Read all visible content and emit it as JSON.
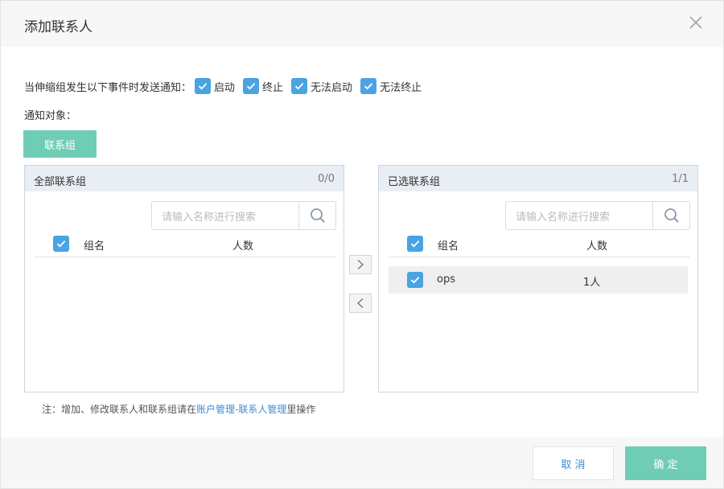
{
  "dialog": {
    "title": "添加联系人",
    "close_icon": "close-icon"
  },
  "notify": {
    "label": "当伸缩组发生以下事件时发送通知：",
    "options": [
      {
        "label": "启动",
        "checked": true
      },
      {
        "label": "终止",
        "checked": true
      },
      {
        "label": "无法启动",
        "checked": true
      },
      {
        "label": "无法终止",
        "checked": true
      }
    ]
  },
  "target": {
    "label": "通知对象：",
    "group_button": "联系组"
  },
  "left_panel": {
    "title": "全部联系组",
    "count": "0/0",
    "search_placeholder": "请输入名称进行搜索",
    "columns": [
      "组名",
      "人数"
    ],
    "rows": []
  },
  "right_panel": {
    "title": "已选联系组",
    "count": "1/1",
    "search_placeholder": "请输入名称进行搜索",
    "columns": [
      "组名",
      "人数"
    ],
    "rows": [
      {
        "name": "ops",
        "count": "1人",
        "checked": true
      }
    ]
  },
  "transfer": {
    "right_icon": "chevron-right-icon",
    "left_icon": "chevron-left-icon"
  },
  "note": {
    "prefix": "注：增加、修改联系人和联系组请在",
    "link": "账户管理-联系人管理",
    "suffix": "里操作"
  },
  "footer": {
    "cancel_label": "取 消",
    "ok_label": "确 定"
  },
  "colors": {
    "checkbox": "#4aa3e2",
    "primary_green": "#6fcdb5",
    "link_blue": "#3c8ad9"
  }
}
